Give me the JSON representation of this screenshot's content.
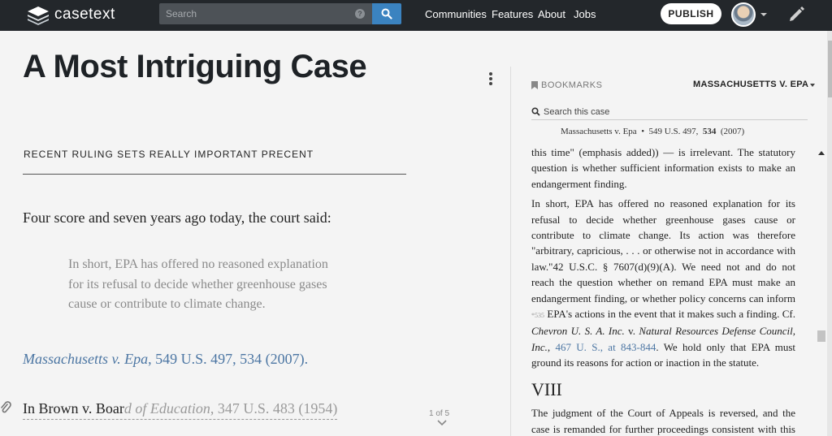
{
  "topbar": {
    "brand": "casetext",
    "search_placeholder": "Search",
    "nav": [
      "Communities",
      "Features",
      "About",
      "Jobs"
    ],
    "publish_label": "PUBLISH"
  },
  "article": {
    "title": "A Most Intriguing Case",
    "subtitle": "RECENT RULING SETS REALLY IMPORTANT PRECENT",
    "intro": "Four score and seven years ago today, the court said:",
    "quote": "In short, EPA has offered no reasoned explanation for its refusal to decide whether greenhouse gases cause or contribute to climate change.",
    "citation_case": "Massachusetts v. Epa",
    "citation_rest": ", 549 U.S. 497, 534 (2007).",
    "brown_dark": "In Brown v. Boar",
    "brown_fade_case": "d of Education",
    "brown_fade_rest": ", 347 U.S. 483 (1954)",
    "pager": "1 of 5"
  },
  "panel": {
    "bookmarks_label": "BOOKMARKS",
    "case_select": "MASSACHUSETTS V. EPA",
    "search_placeholder": "Search this case",
    "cite_name": "Massachusetts v. Epa",
    "cite_sep": "•",
    "cite_reporter": "549 U.S. 497,",
    "cite_page": "534",
    "cite_year": "(2007)"
  },
  "opinion": {
    "p1": "this time\" (emphasis added)) — is irrelevant. The statutory question is whether sufficient information exists to make an endangerment finding.",
    "p2a": "In short, EPA has offered no reasoned explanation for its refusal to decide whether greenhouse gases cause or contribute to climate change. Its action was therefore \"arbitrary, capricious, . . . or otherwise not in accordance with law.\"42 U.S.C. § 7607(d)(9)(A). We need not and do not reach the question whether on remand EPA must make an endangerment finding, or whether policy concerns can inform",
    "p2star": "*535",
    "p2b": "EPA's actions in the event that it makes such a finding. Cf.",
    "p2case1": "Chevron U. S. A. Inc.",
    "p2v": "v.",
    "p2case2": "Natural Resources Defense Council, Inc.",
    "p2comma": ",",
    "p2link": "467 U. S., at 843-844",
    "p2c": ". We hold only that EPA must ground its reasons for action or inaction in the statute.",
    "heading": "VIII",
    "p3": "The judgment of the Court of Appeals is reversed, and the case is remanded for further proceedings consistent with this opinion."
  },
  "icons": {
    "logo": "stacked-layers-logo",
    "search": "magnifier-icon",
    "help": "question-circle-icon",
    "pencil": "pencil-icon",
    "bookmark": "bookmark-icon",
    "paperclip": "paperclip-icon",
    "kebab": "vertical-dots-icon",
    "chevron": "chevron-down-icon"
  },
  "colors": {
    "topbar_bg": "#23272b",
    "accent": "#3b83c0",
    "link": "#4c76a3",
    "page_bg": "#f4f4f4"
  }
}
